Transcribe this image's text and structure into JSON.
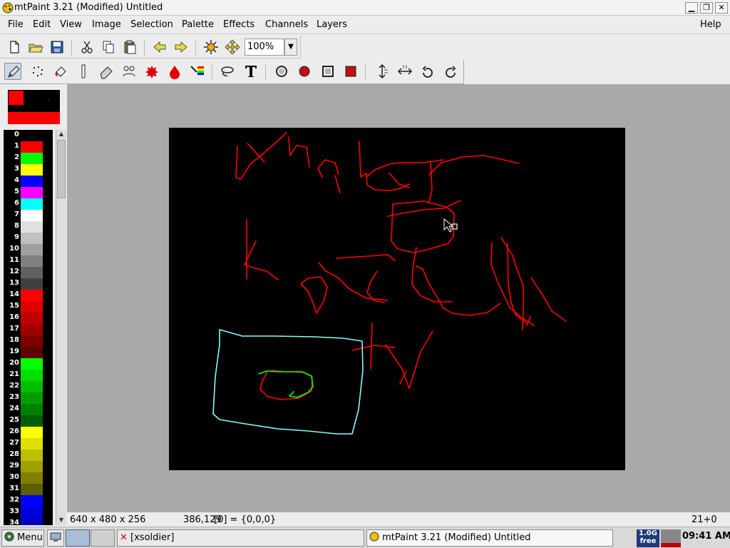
{
  "window": {
    "title": "mtPaint 3.21 (Modified) Untitled"
  },
  "menu": {
    "items": [
      "File",
      "Edit",
      "View",
      "Image",
      "Selection",
      "Palette",
      "Effects",
      "Channels",
      "Layers"
    ],
    "help": "Help"
  },
  "toolbar": {
    "zoom": "100%"
  },
  "palette": {
    "colors": [
      "#000000",
      "#ff0000",
      "#00ff00",
      "#ffff00",
      "#0000ff",
      "#ff00ff",
      "#00ffff",
      "#ffffff",
      "#e0e0e0",
      "#c0c0c0",
      "#a0a0a0",
      "#808080",
      "#606060",
      "#404040",
      "#ff0000",
      "#df0000",
      "#bf0000",
      "#9f0000",
      "#7f0000",
      "#5f0000",
      "#00ff00",
      "#00df00",
      "#00bf00",
      "#009f00",
      "#007f00",
      "#005f00",
      "#ffff00",
      "#dfdf00",
      "#bfbf00",
      "#9f9f00",
      "#7f7f00",
      "#5f5f00",
      "#0000ff",
      "#0000df",
      "#0000bf"
    ],
    "indices": [
      "0",
      "1",
      "2",
      "3",
      "4",
      "5",
      "6",
      "7",
      "8",
      "9",
      "10",
      "11",
      "12",
      "13",
      "14",
      "15",
      "16",
      "17",
      "18",
      "19",
      "20",
      "21",
      "22",
      "23",
      "24",
      "25",
      "26",
      "27",
      "28",
      "29",
      "30",
      "31",
      "32",
      "33",
      "34"
    ],
    "foreground": "#ff0000",
    "background": "#000000"
  },
  "canvas": {
    "background": "#000000",
    "surround": "#a9a9a9",
    "stroke_red": "#ff0000",
    "stroke_cyan": "#80ffff",
    "stroke_green": "#00ff00"
  },
  "status": {
    "dimensions": "640 x 480 x 256",
    "cursor": "386,129",
    "pixel": "[0] = {0,0,0}",
    "right": "21+0"
  },
  "taskbar": {
    "menu": "Menu",
    "task1": "[xsoldier]",
    "task2": "mtPaint 3.21 (Modified) Untitled",
    "mem_top": "1.0G",
    "mem_bottom": "free",
    "clock": "09:41 AM"
  }
}
